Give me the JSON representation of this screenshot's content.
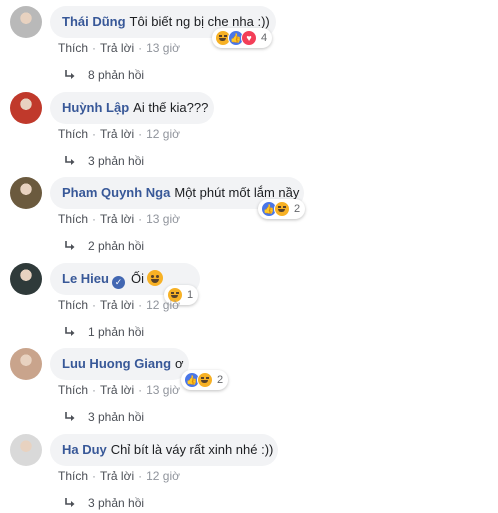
{
  "comments": [
    {
      "author": "Thái Dũng",
      "text": "Tôi biết ng bị che nha :))",
      "verified": false,
      "inline_emoji": false,
      "avatar_color": "#b9b9b9",
      "reactions": {
        "icons": [
          "haha",
          "like",
          "love"
        ],
        "count": "4"
      },
      "actions": {
        "like": "Thích",
        "reply": "Trả lời",
        "time": "13 giờ"
      },
      "replies": "8 phản hồi"
    },
    {
      "author": "Huỳnh Lập",
      "text": "Ai thế kia???",
      "verified": false,
      "inline_emoji": false,
      "avatar_color": "#c0392b",
      "reactions": null,
      "actions": {
        "like": "Thích",
        "reply": "Trả lời",
        "time": "12 giờ"
      },
      "replies": "3 phản hồi"
    },
    {
      "author": "Pham Quynh Nga",
      "text": "Một phút mốt lắm nầy",
      "verified": false,
      "inline_emoji": false,
      "avatar_color": "#6b5a3e",
      "reactions": {
        "icons": [
          "like",
          "haha"
        ],
        "count": "2"
      },
      "actions": {
        "like": "Thích",
        "reply": "Trả lời",
        "time": "13 giờ"
      },
      "replies": "2 phản hồi"
    },
    {
      "author": "Le Hieu",
      "text": "Ối",
      "verified": true,
      "inline_emoji": true,
      "avatar_color": "#2f3a3a",
      "reactions": {
        "icons": [
          "haha"
        ],
        "count": "1"
      },
      "actions": {
        "like": "Thích",
        "reply": "Trả lời",
        "time": "12 giờ"
      },
      "replies": "1 phản hồi"
    },
    {
      "author": "Luu Huong Giang",
      "text": "ơ",
      "verified": false,
      "inline_emoji": false,
      "avatar_color": "#c9a48c",
      "reactions": {
        "icons": [
          "like",
          "haha"
        ],
        "count": "2"
      },
      "actions": {
        "like": "Thích",
        "reply": "Trả lời",
        "time": "13 giờ"
      },
      "replies": "3 phản hồi"
    },
    {
      "author": "Ha Duy",
      "text": "Chỉ bít là váy rất xinh nhé :))",
      "verified": false,
      "inline_emoji": false,
      "avatar_color": "#d9d9d9",
      "reactions": null,
      "actions": {
        "like": "Thích",
        "reply": "Trả lời",
        "time": "12 giờ"
      },
      "replies": "3 phản hồi"
    }
  ],
  "colors": {
    "author_link": "#385898",
    "bubble_bg": "#f2f3f5",
    "like_blue": "#4a77e8",
    "haha_yellow": "#f7b125",
    "love_red": "#f33e58"
  }
}
